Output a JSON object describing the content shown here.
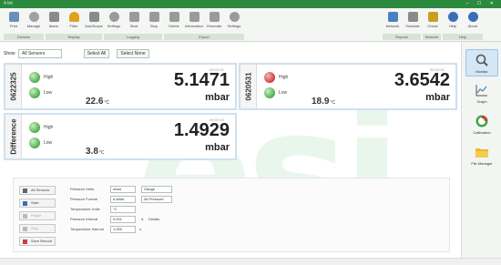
{
  "window": {
    "title": "4 Int",
    "controls": "– ☐ ✕"
  },
  "ribbon": {
    "buttons": [
      {
        "label": "Print",
        "icon": "print-icon",
        "color": "#6a8fb8"
      },
      {
        "label": "Manage",
        "icon": "manage-icon",
        "color": "#a0a0a0"
      },
      {
        "label": "Alarm",
        "icon": "alarm-icon",
        "color": "#8a8a8a"
      },
      {
        "label": "Filter",
        "icon": "filter-icon",
        "color": "#e0a020"
      },
      {
        "label": "AutoScope",
        "icon": "autoscope-icon",
        "color": "#8a8a8a"
      },
      {
        "label": "Settings",
        "icon": "settings-icon",
        "color": "#9a9a9a"
      },
      {
        "label": "Start",
        "icon": "start-icon",
        "color": "#9a9a9a"
      },
      {
        "label": "Stop",
        "icon": "stop-icon",
        "color": "#9a9a9a"
      },
      {
        "label": "Delete",
        "icon": "delete-icon",
        "color": "#9a9a9a"
      },
      {
        "label": "Information",
        "icon": "information-icon",
        "color": "#9a9a9a"
      },
      {
        "label": "Generate",
        "icon": "generate-icon",
        "color": "#9a9a9a"
      },
      {
        "label": "Settings",
        "icon": "settings2-icon",
        "color": "#9a9a9a"
      }
    ],
    "right_buttons": [
      {
        "label": "Network",
        "icon": "network-icon",
        "color": "#4a80c0"
      },
      {
        "label": "Simulate",
        "icon": "simulate-icon",
        "color": "#8a8a8a"
      },
      {
        "label": "Check",
        "icon": "check-icon",
        "color": "#c8a020"
      },
      {
        "label": "Help",
        "icon": "help-icon",
        "color": "#3a6fb8"
      },
      {
        "label": "About",
        "icon": "about-icon",
        "color": "#3a6fb8"
      }
    ],
    "groups": [
      "Devices",
      "Display",
      "Logging",
      "Export",
      "Reports",
      "Network",
      "Help"
    ]
  },
  "filter": {
    "show_label": "Show",
    "select_value": "All Sensors",
    "select_all": "Select All",
    "select_none": "Select None"
  },
  "panels": [
    {
      "device_id": "0622325",
      "led_high": "High",
      "led_low": "Low",
      "temperature": "22.6",
      "temp_unit": "°C",
      "value": "5.1471",
      "unit": "mbar",
      "timestamp": "09:03:15"
    },
    {
      "device_id": "0620531",
      "led_high": "High",
      "led_low": "Low",
      "temperature": "18.9",
      "temp_unit": "°C",
      "value": "3.6542",
      "unit": "mbar",
      "timestamp": "09:03:15"
    },
    {
      "device_id": "Difference",
      "led_high": "High",
      "led_low": "Low",
      "temperature": "3.8",
      "temp_unit": "°C",
      "value": "1.4929",
      "unit": "mbar",
      "timestamp": "09:03:15"
    }
  ],
  "sidebar": {
    "items": [
      {
        "label": "Monitor",
        "icon": "monitor-icon"
      },
      {
        "label": "Graph",
        "icon": "graph-icon"
      },
      {
        "label": "Calibration",
        "icon": "calibration-icon"
      },
      {
        "label": "File Manager",
        "icon": "file-manager-icon"
      }
    ]
  },
  "controls": {
    "buttons": [
      "All Sensors",
      "Start",
      "Pause",
      "Stop",
      "Save Record"
    ],
    "fields": [
      {
        "label": "Pressure Units",
        "value": "mbar",
        "value2": "Gauge"
      },
      {
        "label": "Pressure Format",
        "value": "#.####",
        "value2": "All Pressure"
      },
      {
        "label": "Temperature Units",
        "value": "°C",
        "value2": ""
      },
      {
        "label": "Pressure Interval",
        "value": "0.001",
        "value2": "",
        "aux": "Details"
      },
      {
        "label": "Temperature Interval",
        "value": "1.000",
        "value2": "",
        "aux": "s"
      }
    ]
  },
  "watermark": "esi",
  "colors": {
    "brand": "#2b8a3e",
    "panel_border": "#cfe0ee",
    "led_green": "#4cae4c",
    "led_red": "#d23b3b"
  }
}
